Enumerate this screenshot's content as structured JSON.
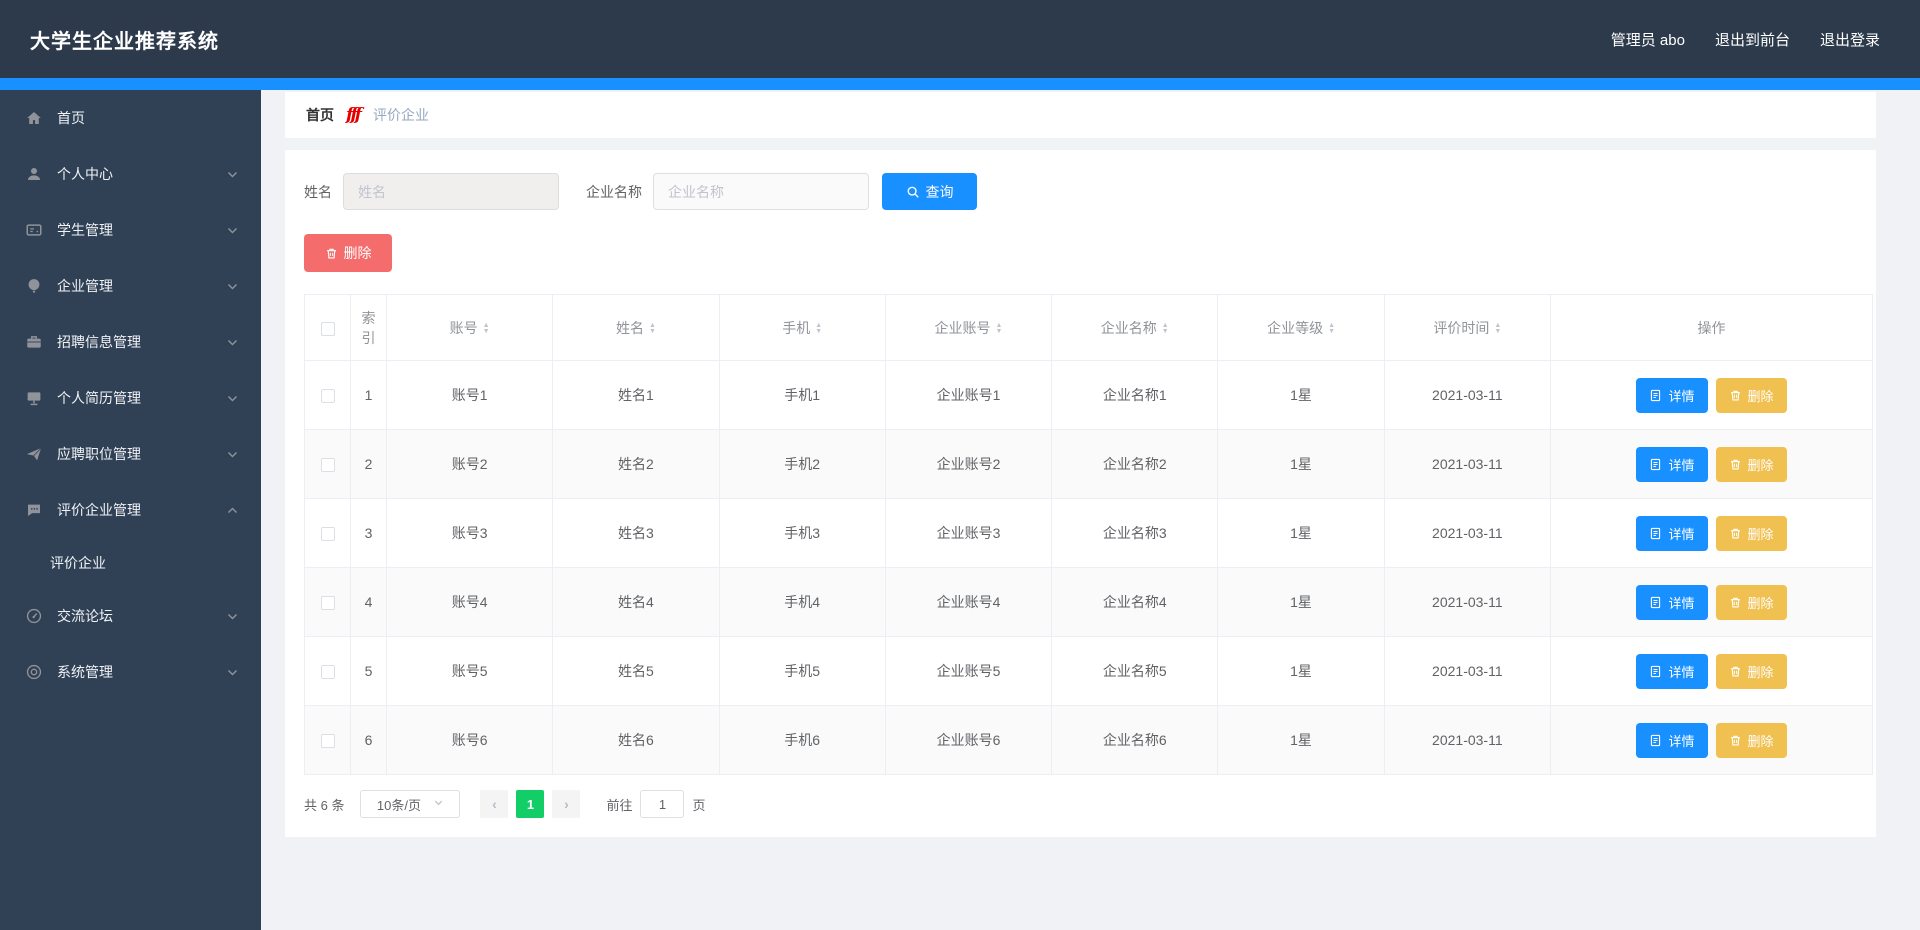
{
  "header": {
    "title": "大学生企业推荐系统",
    "user_label": "管理员 abo",
    "exit_front_label": "退出到前台",
    "logout_label": "退出登录"
  },
  "sidebar": {
    "items": [
      {
        "label": "首页",
        "icon": "home-icon",
        "chevron": null
      },
      {
        "label": "个人中心",
        "icon": "user-icon",
        "chevron": "down"
      },
      {
        "label": "学生管理",
        "icon": "form-icon",
        "chevron": "down"
      },
      {
        "label": "企业管理",
        "icon": "balloon-icon",
        "chevron": "down"
      },
      {
        "label": "招聘信息管理",
        "icon": "briefcase-icon",
        "chevron": "down"
      },
      {
        "label": "个人简历管理",
        "icon": "monitor-icon",
        "chevron": "down"
      },
      {
        "label": "应聘职位管理",
        "icon": "send-icon",
        "chevron": "down"
      },
      {
        "label": "评价企业管理",
        "icon": "chat-icon",
        "chevron": "up",
        "children": [
          {
            "label": "评价企业"
          }
        ]
      },
      {
        "label": "交流论坛",
        "icon": "gauge-icon",
        "chevron": "down"
      },
      {
        "label": "系统管理",
        "icon": "settings-icon",
        "chevron": "down"
      }
    ]
  },
  "breadcrumb": {
    "home": "首页",
    "separator": "fff",
    "current": "评价企业"
  },
  "search": {
    "name_label": "姓名",
    "name_placeholder": "姓名",
    "company_label": "企业名称",
    "company_placeholder": "企业名称",
    "query_label": "查询"
  },
  "toolbar": {
    "delete_label": "删除"
  },
  "table": {
    "columns": [
      {
        "label": "索引",
        "sortable": false
      },
      {
        "label": "账号",
        "sortable": true
      },
      {
        "label": "姓名",
        "sortable": true
      },
      {
        "label": "手机",
        "sortable": true
      },
      {
        "label": "企业账号",
        "sortable": true
      },
      {
        "label": "企业名称",
        "sortable": true
      },
      {
        "label": "企业等级",
        "sortable": true
      },
      {
        "label": "评价时间",
        "sortable": true
      },
      {
        "label": "操作",
        "sortable": false
      }
    ],
    "rows": [
      [
        "1",
        "账号1",
        "姓名1",
        "手机1",
        "企业账号1",
        "企业名称1",
        "1星",
        "2021-03-11"
      ],
      [
        "2",
        "账号2",
        "姓名2",
        "手机2",
        "企业账号2",
        "企业名称2",
        "1星",
        "2021-03-11"
      ],
      [
        "3",
        "账号3",
        "姓名3",
        "手机3",
        "企业账号3",
        "企业名称3",
        "1星",
        "2021-03-11"
      ],
      [
        "4",
        "账号4",
        "姓名4",
        "手机4",
        "企业账号4",
        "企业名称4",
        "1星",
        "2021-03-11"
      ],
      [
        "5",
        "账号5",
        "姓名5",
        "手机5",
        "企业账号5",
        "企业名称5",
        "1星",
        "2021-03-11"
      ],
      [
        "6",
        "账号6",
        "姓名6",
        "手机6",
        "企业账号6",
        "企业名称6",
        "1星",
        "2021-03-11"
      ]
    ],
    "actions": {
      "detail_label": "详情",
      "delete_label": "删除"
    }
  },
  "pagination": {
    "total_label": "共 6 条",
    "page_size_label": "10条/页",
    "current_page": "1",
    "goto_label": "前往",
    "goto_value": "1",
    "page_unit_label": "页"
  },
  "colors": {
    "accent_blue": "#1890ff",
    "danger_red": "#f56c6c",
    "warning_yellow": "#f0c050",
    "pager_green": "#13ce66",
    "header_bg": "#2d3a4b",
    "sidebar_bg": "#304156"
  }
}
